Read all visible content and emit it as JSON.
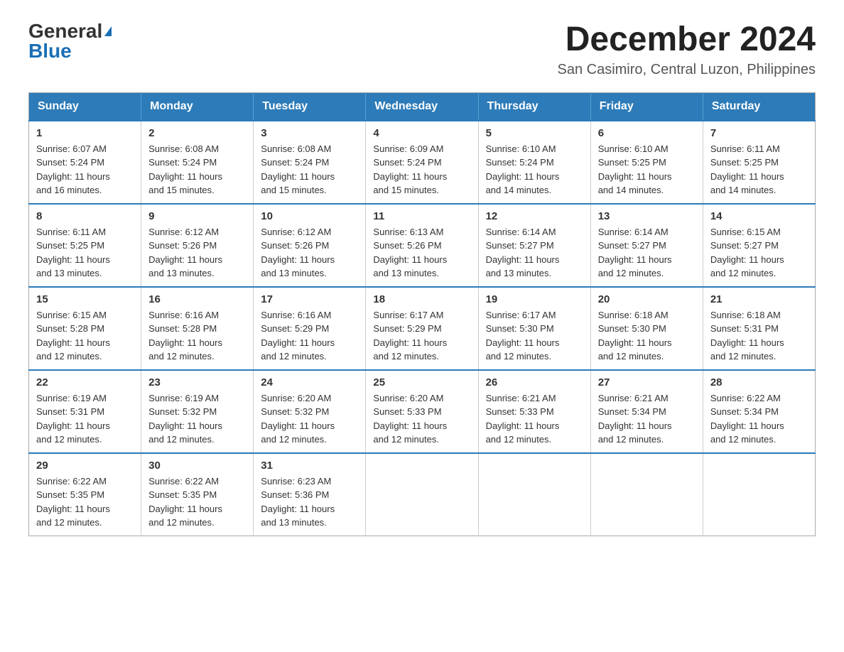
{
  "logo": {
    "general": "General",
    "blue": "Blue"
  },
  "title": "December 2024",
  "subtitle": "San Casimiro, Central Luzon, Philippines",
  "days_header": [
    "Sunday",
    "Monday",
    "Tuesday",
    "Wednesday",
    "Thursday",
    "Friday",
    "Saturday"
  ],
  "weeks": [
    [
      {
        "day": "1",
        "sunrise": "6:07 AM",
        "sunset": "5:24 PM",
        "daylight": "11 hours and 16 minutes."
      },
      {
        "day": "2",
        "sunrise": "6:08 AM",
        "sunset": "5:24 PM",
        "daylight": "11 hours and 15 minutes."
      },
      {
        "day": "3",
        "sunrise": "6:08 AM",
        "sunset": "5:24 PM",
        "daylight": "11 hours and 15 minutes."
      },
      {
        "day": "4",
        "sunrise": "6:09 AM",
        "sunset": "5:24 PM",
        "daylight": "11 hours and 15 minutes."
      },
      {
        "day": "5",
        "sunrise": "6:10 AM",
        "sunset": "5:24 PM",
        "daylight": "11 hours and 14 minutes."
      },
      {
        "day": "6",
        "sunrise": "6:10 AM",
        "sunset": "5:25 PM",
        "daylight": "11 hours and 14 minutes."
      },
      {
        "day": "7",
        "sunrise": "6:11 AM",
        "sunset": "5:25 PM",
        "daylight": "11 hours and 14 minutes."
      }
    ],
    [
      {
        "day": "8",
        "sunrise": "6:11 AM",
        "sunset": "5:25 PM",
        "daylight": "11 hours and 13 minutes."
      },
      {
        "day": "9",
        "sunrise": "6:12 AM",
        "sunset": "5:26 PM",
        "daylight": "11 hours and 13 minutes."
      },
      {
        "day": "10",
        "sunrise": "6:12 AM",
        "sunset": "5:26 PM",
        "daylight": "11 hours and 13 minutes."
      },
      {
        "day": "11",
        "sunrise": "6:13 AM",
        "sunset": "5:26 PM",
        "daylight": "11 hours and 13 minutes."
      },
      {
        "day": "12",
        "sunrise": "6:14 AM",
        "sunset": "5:27 PM",
        "daylight": "11 hours and 13 minutes."
      },
      {
        "day": "13",
        "sunrise": "6:14 AM",
        "sunset": "5:27 PM",
        "daylight": "11 hours and 12 minutes."
      },
      {
        "day": "14",
        "sunrise": "6:15 AM",
        "sunset": "5:27 PM",
        "daylight": "11 hours and 12 minutes."
      }
    ],
    [
      {
        "day": "15",
        "sunrise": "6:15 AM",
        "sunset": "5:28 PM",
        "daylight": "11 hours and 12 minutes."
      },
      {
        "day": "16",
        "sunrise": "6:16 AM",
        "sunset": "5:28 PM",
        "daylight": "11 hours and 12 minutes."
      },
      {
        "day": "17",
        "sunrise": "6:16 AM",
        "sunset": "5:29 PM",
        "daylight": "11 hours and 12 minutes."
      },
      {
        "day": "18",
        "sunrise": "6:17 AM",
        "sunset": "5:29 PM",
        "daylight": "11 hours and 12 minutes."
      },
      {
        "day": "19",
        "sunrise": "6:17 AM",
        "sunset": "5:30 PM",
        "daylight": "11 hours and 12 minutes."
      },
      {
        "day": "20",
        "sunrise": "6:18 AM",
        "sunset": "5:30 PM",
        "daylight": "11 hours and 12 minutes."
      },
      {
        "day": "21",
        "sunrise": "6:18 AM",
        "sunset": "5:31 PM",
        "daylight": "11 hours and 12 minutes."
      }
    ],
    [
      {
        "day": "22",
        "sunrise": "6:19 AM",
        "sunset": "5:31 PM",
        "daylight": "11 hours and 12 minutes."
      },
      {
        "day": "23",
        "sunrise": "6:19 AM",
        "sunset": "5:32 PM",
        "daylight": "11 hours and 12 minutes."
      },
      {
        "day": "24",
        "sunrise": "6:20 AM",
        "sunset": "5:32 PM",
        "daylight": "11 hours and 12 minutes."
      },
      {
        "day": "25",
        "sunrise": "6:20 AM",
        "sunset": "5:33 PM",
        "daylight": "11 hours and 12 minutes."
      },
      {
        "day": "26",
        "sunrise": "6:21 AM",
        "sunset": "5:33 PM",
        "daylight": "11 hours and 12 minutes."
      },
      {
        "day": "27",
        "sunrise": "6:21 AM",
        "sunset": "5:34 PM",
        "daylight": "11 hours and 12 minutes."
      },
      {
        "day": "28",
        "sunrise": "6:22 AM",
        "sunset": "5:34 PM",
        "daylight": "11 hours and 12 minutes."
      }
    ],
    [
      {
        "day": "29",
        "sunrise": "6:22 AM",
        "sunset": "5:35 PM",
        "daylight": "11 hours and 12 minutes."
      },
      {
        "day": "30",
        "sunrise": "6:22 AM",
        "sunset": "5:35 PM",
        "daylight": "11 hours and 12 minutes."
      },
      {
        "day": "31",
        "sunrise": "6:23 AM",
        "sunset": "5:36 PM",
        "daylight": "11 hours and 13 minutes."
      },
      null,
      null,
      null,
      null
    ]
  ],
  "labels": {
    "sunrise": "Sunrise:",
    "sunset": "Sunset:",
    "daylight": "Daylight:"
  }
}
